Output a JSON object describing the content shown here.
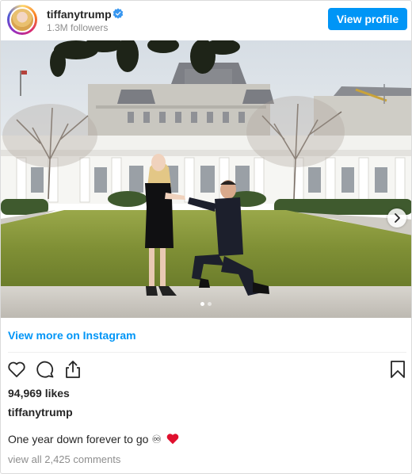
{
  "header": {
    "username": "tiffanytrump",
    "followers": "1.3M followers",
    "view_profile_label": "View profile"
  },
  "photo": {
    "alt": "Photo by tiffanytrump",
    "carousel_count": 2,
    "carousel_active": 1
  },
  "footer": {
    "view_more_label": "View more on Instagram",
    "likes": "94,969 likes",
    "caption_user": "tiffanytrump",
    "caption_text": "One year down forever to go ♾",
    "comments_link": "view all 2,425 comments"
  },
  "icons": [
    "verified-badge-icon",
    "next-arrow-icon",
    "heart-outline-icon",
    "comment-icon",
    "share-icon",
    "bookmark-icon",
    "red-heart-emoji-icon"
  ],
  "colors": {
    "accent": "#0095f6",
    "text": "#262626",
    "muted": "#8e8e8e",
    "emoji_heart": "#e0102e"
  }
}
